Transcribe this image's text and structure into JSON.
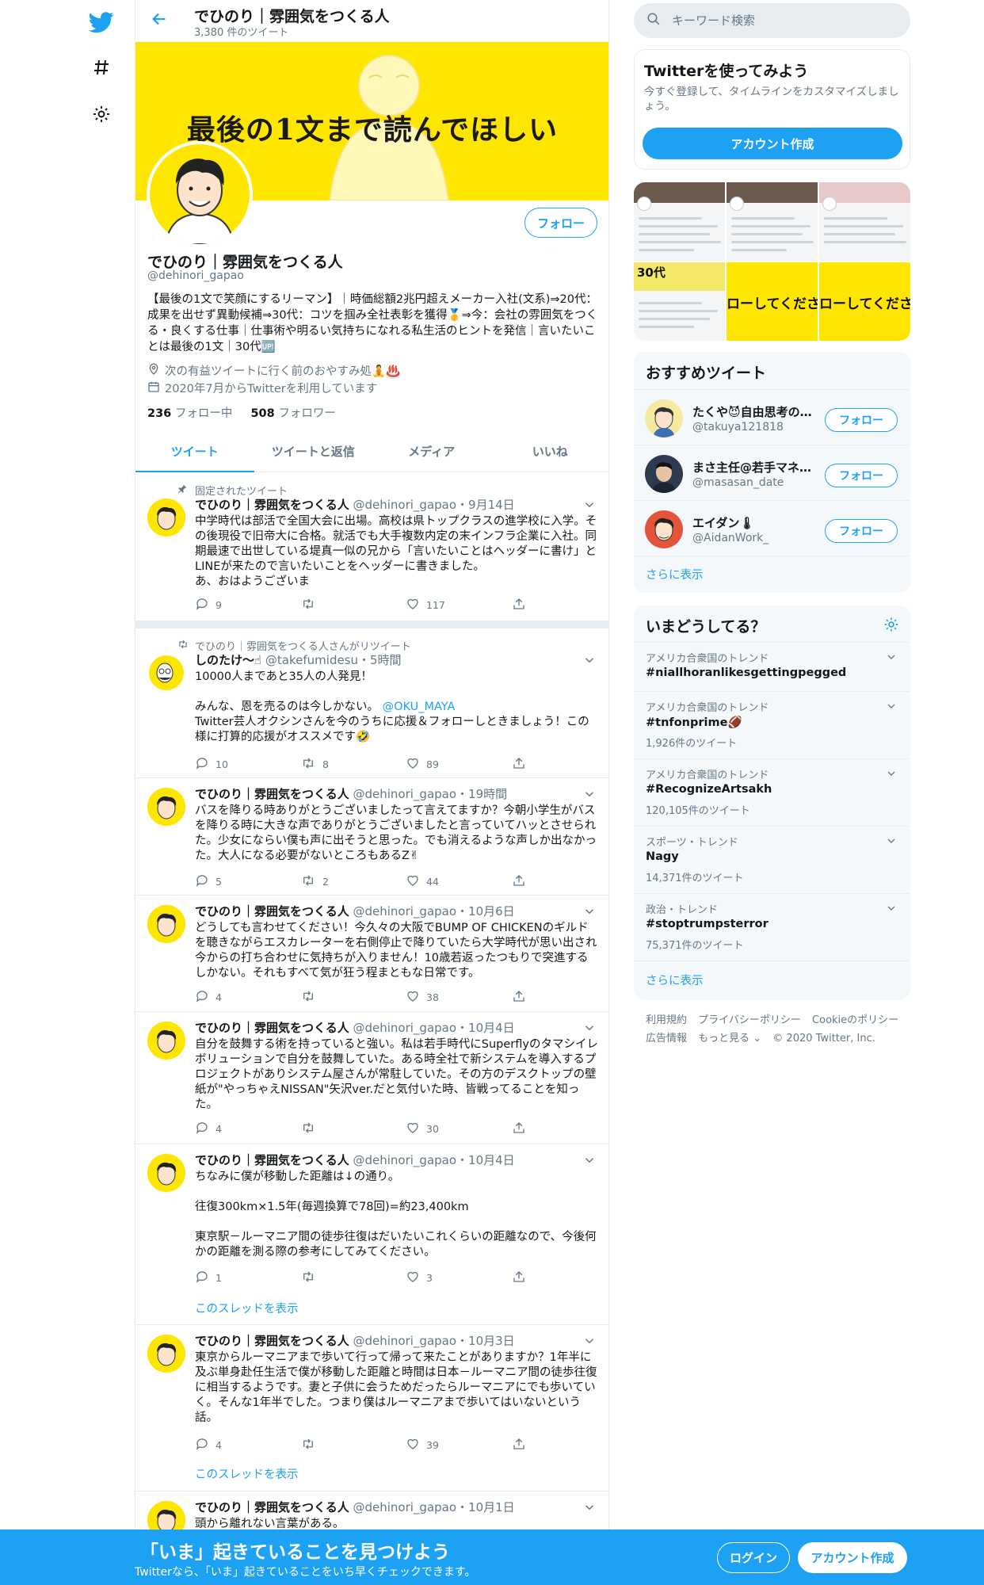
{
  "profile": {
    "name": "でひのり｜雰囲気をつくる人",
    "tweet_count": "3,380 件のツイート",
    "banner_text": "最後の1文まで読んでほしい",
    "handle": "@dehinori_gapao",
    "follow_label": "フォロー",
    "bio": "【最後の1文で笑顔にするリーマン】｜時価総額2兆円超えメーカー入社(文系)⇒20代：成果を出せず異動候補⇒30代：コツを掴み全社表彰を獲得🥇⇒今：会社の雰囲気をつくる・良くする仕事｜仕事術や明るい気持ちになれる私生活のヒントを発信｜言いたいことは最後の1文｜30代🆙",
    "location": "次の有益ツイートに行く前のおやすみ処🧘♨️",
    "joined": "2020年7月からTwitterを利用しています",
    "following_count": "236",
    "following_label": "フォロー中",
    "followers_count": "508",
    "followers_label": "フォロワー"
  },
  "tabs": [
    "ツイート",
    "ツイートと返信",
    "メディア",
    "いいね"
  ],
  "tweets": [
    {
      "context": "固定されたツイート",
      "name": "でひのり｜雰囲気をつくる人",
      "meta": "@dehinori_gapao・9月14日",
      "text": "中学時代は部活で全国大会に出場。高校は県トップクラスの進学校に入学。その後現役で旧帝大に合格。就活でも大手複数内定の末インフラ企業に入社。同期最速で出世している堤真一似の兄から「言いたいことはヘッダーに書け」とLINEが来たので言いたいことをヘッダーに書きました。\nあ、おはようございま",
      "replies": "9",
      "retweets": "",
      "likes": "117"
    },
    {
      "context": "でひのり｜雰囲気をつくる人さんがリツイート",
      "name": "しのたけ〜☝",
      "meta": "@takefumidesu・5時間",
      "text_a": "10000人まであと35人の人発見！\n\nみんな、恩を売るのは今しかない。",
      "mention": "@OKU_MAYA",
      "text_b": "Twitter芸人オクシンさんを今のうちに応援＆フォローしときましょう！この様に打算的応援がオススメです🤣",
      "replies": "10",
      "retweets": "8",
      "likes": "89"
    },
    {
      "name": "でひのり｜雰囲気をつくる人",
      "meta": "@dehinori_gapao・19時間",
      "text": "バスを降りる時ありがとうございましたって言えてますか？今朝小学生がバスを降りる時に大きな声でありがとうございましたと言っていてハッとさせられた。少女にならい僕も声に出そうと思った。でも消えるような声しか出なかった。大人になる必要がないところもあるZ✌",
      "replies": "5",
      "retweets": "2",
      "likes": "44"
    },
    {
      "name": "でひのり｜雰囲気をつくる人",
      "meta": "@dehinori_gapao・10月6日",
      "text": "どうしても言わせてください！今久々の大阪でBUMP OF CHICKENのギルドを聴きながらエスカレーターを右側停止で降りていたら大学時代が思い出され今からの打ち合わせに気持ちが入りません！10歳若返ったつもりで突進するしかない。それもすべて気が狂う程まともな日常です。",
      "replies": "4",
      "retweets": "",
      "likes": "38"
    },
    {
      "name": "でひのり｜雰囲気をつくる人",
      "meta": "@dehinori_gapao・10月4日",
      "text": "自分を鼓舞する術を持っていると強い。私は若手時代にSuperflyのタマシイレボリューションで自分を鼓舞していた。ある時全社で新システムを導入するプロジェクトがありシステム屋さんが常駐していた。その方のデスクトップの壁紙が\"やっちゃえNISSAN\"矢沢ver.だと気付いた時、皆戦ってることを知った。",
      "replies": "4",
      "retweets": "",
      "likes": "30"
    },
    {
      "name": "でひのり｜雰囲気をつくる人",
      "meta": "@dehinori_gapao・10月4日",
      "text": "ちなみに僕が移動した距離は↓の通り。\n\n往復300km×1.5年(毎週換算で78回)=約23,400km\n\n東京駅－ルーマニア間の徒歩往復はだいたいこれくらいの距離なので、今後何かの距離を測る際の参考にしてみてください。",
      "replies": "1",
      "retweets": "",
      "likes": "3",
      "thread": "このスレッドを表示"
    },
    {
      "name": "でひのり｜雰囲気をつくる人",
      "meta": "@dehinori_gapao・10月3日",
      "text": "東京からルーマニアまで歩いて行って帰って来たことがありますか？1年半に及ぶ単身赴任生活で僕が移動した距離と時間は日本－ルーマニア間の徒歩往復に相当するようです。妻と子供に会うためだったらルーマニアにでも歩いていく。そんな1年半でした。つまり僕はルーマニアまで歩いてはいないという話。",
      "replies": "4",
      "retweets": "",
      "likes": "39",
      "thread": "このスレッドを表示"
    },
    {
      "name": "でひのり｜雰囲気をつくる人",
      "meta": "@dehinori_gapao・10月1日",
      "text": "頭から離れない言葉がある。"
    }
  ],
  "sidebar": {
    "search_placeholder": "キーワード検索",
    "signup_title": "Twitterを使ってみよう",
    "signup_desc": "今すぐ登録して、タイムラインをカスタマイズしましょう。",
    "signup_button": "アカウント作成",
    "media_texts": [
      "30代",
      "ローしてくださ",
      "ローしてくださ"
    ],
    "recommend_title": "おすすめツイート",
    "recommend": [
      {
        "name": "たくや😈自由思考の…",
        "handle": "@takuya121818",
        "button": "フォロー"
      },
      {
        "name": "まさ主任@若手マネ…",
        "handle": "@masasan_date",
        "button": "フォロー"
      },
      {
        "name": "エイダン🌡",
        "handle": "@AidanWork_",
        "button": "フォロー"
      }
    ],
    "recommend_more": "さらに表示",
    "trends_title": "いまどうしてる？",
    "trends": [
      {
        "context": "アメリカ合衆国のトレンド",
        "name": "#niallhoranlikesgettingpegged",
        "count": ""
      },
      {
        "context": "アメリカ合衆国のトレンド",
        "name": "#tnfonprime🏈",
        "count": "1,926件のツイート"
      },
      {
        "context": "アメリカ合衆国のトレンド",
        "name": "#RecognizeArtsakh",
        "count": "120,105件のツイート"
      },
      {
        "context": "スポーツ・トレンド",
        "name": "Nagy",
        "count": "14,371件のツイート"
      },
      {
        "context": "政治・トレンド",
        "name": "#stoptrumpsterror",
        "count": "75,371件のツイート"
      }
    ],
    "trends_more": "さらに表示",
    "footer": [
      "利用規約",
      "プライバシーポリシー",
      "Cookieのポリシー",
      "広告情報",
      "もっと見る ⌄",
      "© 2020 Twitter, Inc."
    ]
  },
  "bottom_bar": {
    "title": "「いま」起きていることを見つけよう",
    "subtitle": "Twitterなら、「いま」起きていることをいち早くチェックできます。",
    "login": "ログイン",
    "signup": "アカウント作成"
  },
  "colors": {
    "accent": "#1da1f2",
    "banner": "#ffe600",
    "border": "#e6ecf0",
    "muted": "#657786"
  },
  "icons": [
    "twitter-bird-icon",
    "hashtag-icon",
    "gear-icon",
    "back-arrow-icon",
    "location-icon",
    "calendar-icon",
    "pin-icon",
    "retweet-icon",
    "reply-icon",
    "like-icon",
    "share-icon",
    "chevron-down-icon",
    "search-icon"
  ]
}
